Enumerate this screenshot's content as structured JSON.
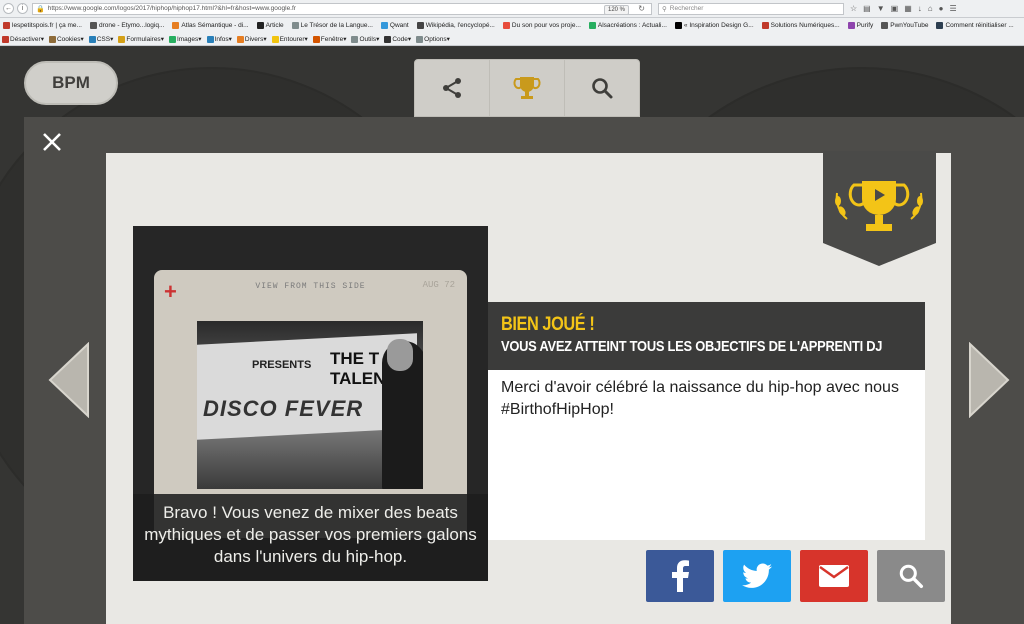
{
  "browser": {
    "url": "https://www.google.com/logos/2017/hiphop/hiphop17.html?&hl=fr&host=www.google.fr",
    "zoom": "120 %",
    "search_placeholder": "Rechercher"
  },
  "bookmarks": [
    {
      "label": "lespetitspois.fr | ça me...",
      "color": "#c0392b"
    },
    {
      "label": "drone - Etymo...logiq...",
      "color": "#555555"
    },
    {
      "label": "Atlas Sémantique - di...",
      "color": "#e67e22"
    },
    {
      "label": "Article",
      "color": "#222222"
    },
    {
      "label": "Le Trésor de la Langue...",
      "color": "#7f8c8d"
    },
    {
      "label": "Qwant",
      "color": "#3498db"
    },
    {
      "label": "Wikipédia, l'encyclopé...",
      "color": "#444444"
    },
    {
      "label": "Du son pour vos proje...",
      "color": "#e74c3c"
    },
    {
      "label": "Alsacréations : Actuali...",
      "color": "#27ae60"
    },
    {
      "label": "« Inspiration Design G...",
      "color": "#000000"
    },
    {
      "label": "Solutions Numériques...",
      "color": "#c0392b"
    },
    {
      "label": "Purify",
      "color": "#8e44ad"
    },
    {
      "label": "PwnYouTube",
      "color": "#555555"
    },
    {
      "label": "Comment réinitialiser ...",
      "color": "#2c3e50"
    }
  ],
  "dev_toolbar": [
    {
      "label": "Désactiver",
      "color": "#c0392b"
    },
    {
      "label": "Cookies",
      "color": "#8e6c3a"
    },
    {
      "label": "CSS",
      "color": "#2980b9"
    },
    {
      "label": "Formulaires",
      "color": "#d4a017"
    },
    {
      "label": "Images",
      "color": "#27ae60"
    },
    {
      "label": "Infos",
      "color": "#2980b9"
    },
    {
      "label": "Divers",
      "color": "#e67e22"
    },
    {
      "label": "Entourer",
      "color": "#f1c40f"
    },
    {
      "label": "Fenêtre",
      "color": "#d35400"
    },
    {
      "label": "Outils",
      "color": "#7f8c8d"
    },
    {
      "label": "Code",
      "color": "#333333"
    },
    {
      "label": "Options",
      "color": "#7f8c8d"
    }
  ],
  "doodle": {
    "bpm_label": "BPM",
    "photo": {
      "slide_header": "VIEW FROM THIS SIDE",
      "slide_plus": "+",
      "slide_corner": "AUG 72",
      "sign_presents": "PRESENTS",
      "sign_title": "THE T TALEN",
      "sign_disco": "DISCO FEVER",
      "caption": "Bravo ! Vous venez de mixer des beats mythiques et de passer vos premiers galons dans l'univers du hip-hop."
    },
    "achievement": {
      "title": "BIEN JOUÉ !",
      "subtitle": "VOUS AVEZ ATTEINT TOUS LES OBJECTIFS DE L'APPRENTI DJ",
      "message": "Merci d'avoir célébré la naissance du hip-hop avec nous #BirthofHipHop!"
    },
    "colors": {
      "facebook": "#3b5998",
      "twitter": "#1da1f2",
      "email": "#d7342b",
      "search": "#8a8a8a",
      "trophy": "#f3c417"
    }
  }
}
